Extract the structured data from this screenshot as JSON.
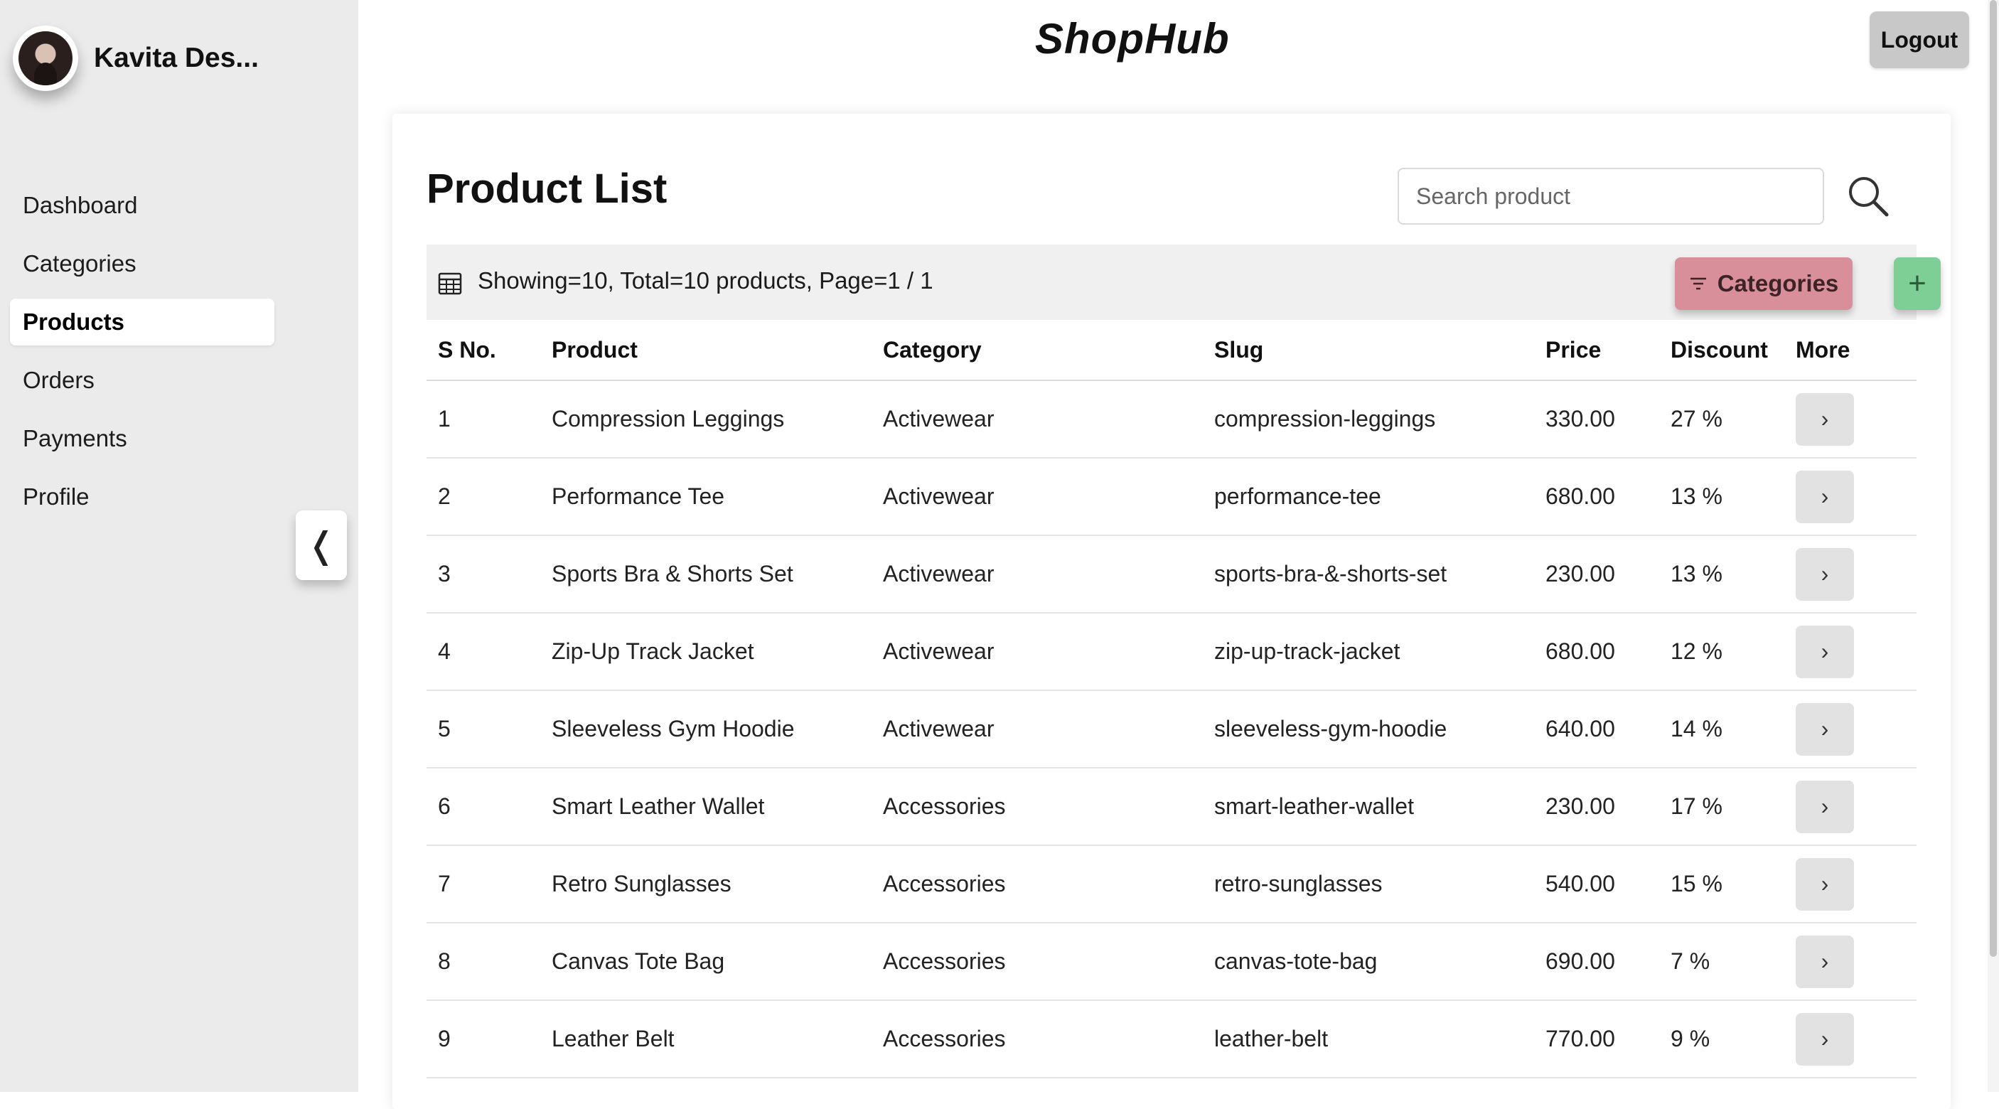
{
  "app": {
    "brand": "ShopHub"
  },
  "user": {
    "name": "Kavita Des..."
  },
  "header": {
    "logout_label": "Logout"
  },
  "sidebar": {
    "items": [
      {
        "label": "Dashboard",
        "active": false
      },
      {
        "label": "Categories",
        "active": false
      },
      {
        "label": "Products",
        "active": true
      },
      {
        "label": "Orders",
        "active": false
      },
      {
        "label": "Payments",
        "active": false
      },
      {
        "label": "Profile",
        "active": false
      }
    ],
    "collapse_glyph": "❬"
  },
  "main": {
    "title": "Product List",
    "search": {
      "placeholder": "Search product",
      "value": ""
    },
    "info_text": "Showing=10, Total=10 products, Page=1 / 1",
    "categories_button": "Categories",
    "add_button": "+",
    "more_glyph": "›",
    "table": {
      "headers": [
        "S No.",
        "Product",
        "Category",
        "Slug",
        "Price",
        "Discount",
        "More"
      ],
      "rows": [
        [
          "1",
          "Compression Leggings",
          "Activewear",
          "compression-leggings",
          "330.00",
          "27 %"
        ],
        [
          "2",
          "Performance Tee",
          "Activewear",
          "performance-tee",
          "680.00",
          "13 %"
        ],
        [
          "3",
          "Sports Bra & Shorts Set",
          "Activewear",
          "sports-bra-&-shorts-set",
          "230.00",
          "13 %"
        ],
        [
          "4",
          "Zip-Up Track Jacket",
          "Activewear",
          "zip-up-track-jacket",
          "680.00",
          "12 %"
        ],
        [
          "5",
          "Sleeveless Gym Hoodie",
          "Activewear",
          "sleeveless-gym-hoodie",
          "640.00",
          "14 %"
        ],
        [
          "6",
          "Smart Leather Wallet",
          "Accessories",
          "smart-leather-wallet",
          "230.00",
          "17 %"
        ],
        [
          "7",
          "Retro Sunglasses",
          "Accessories",
          "retro-sunglasses",
          "540.00",
          "15 %"
        ],
        [
          "8",
          "Canvas Tote Bag",
          "Accessories",
          "canvas-tote-bag",
          "690.00",
          "7 %"
        ],
        [
          "9",
          "Leather Belt",
          "Accessories",
          "leather-belt",
          "770.00",
          "9 %"
        ]
      ]
    }
  },
  "colors": {
    "sidebar_bg": "#ebebeb",
    "categories_button_bg": "#d98f99",
    "add_button_bg": "#7ecf95",
    "logout_bg": "#c8c8c8"
  }
}
